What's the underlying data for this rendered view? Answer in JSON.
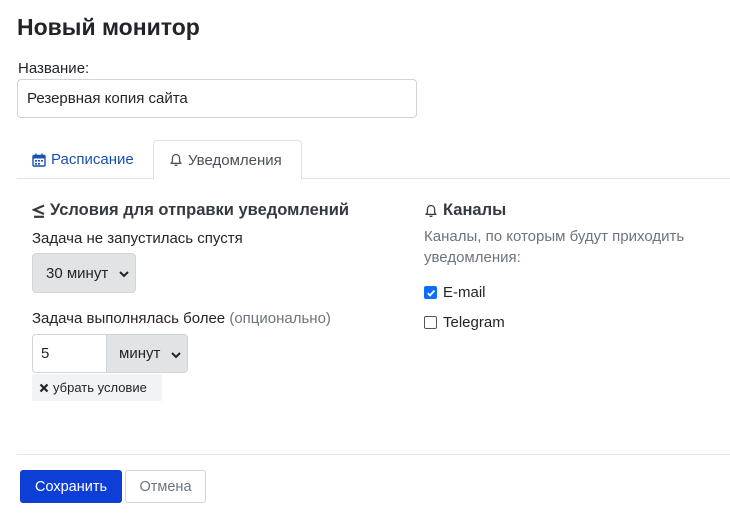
{
  "page": {
    "title": "Новый монитор"
  },
  "form": {
    "name_label": "Название:",
    "name_value": "Резервная копия сайта"
  },
  "tabs": [
    {
      "label": "Расписание",
      "icon": "calendar-icon",
      "active": false
    },
    {
      "label": "Уведомления",
      "icon": "bell-icon",
      "active": true
    }
  ],
  "conditions": {
    "heading": "Условия для отправки уведомлений",
    "icon": "less-equal-icon",
    "not_started_label": "Задача не запустилась спустя",
    "not_started_value": "30 минут",
    "ran_longer_label": "Задача выполнялась более",
    "ran_longer_optional": "(опционально)",
    "ran_longer_value": "5",
    "ran_longer_unit": "минут",
    "remove_label": "убрать условие"
  },
  "channels": {
    "heading": "Каналы",
    "icon": "bell-icon",
    "description": "Каналы, по которым будут приходить уведомления:",
    "items": [
      {
        "label": "E-mail",
        "checked": true
      },
      {
        "label": "Telegram",
        "checked": false
      }
    ]
  },
  "actions": {
    "save_label": "Сохранить",
    "cancel_label": "Отмена"
  },
  "colors": {
    "accent": "#0d6efd",
    "save_button": "#0d3fd6",
    "select_bg": "#e2e3e5"
  }
}
